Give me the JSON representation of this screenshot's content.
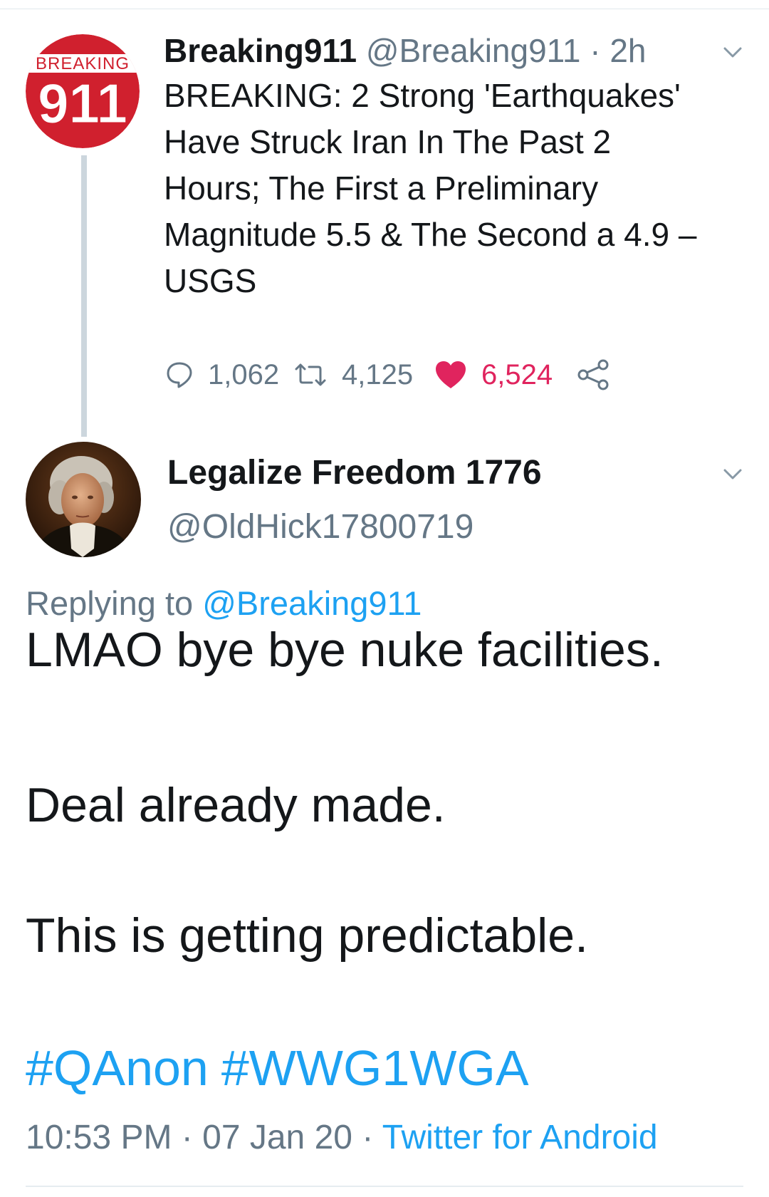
{
  "original_tweet": {
    "avatar_text_top": "BREAKING",
    "avatar_text_big": "911",
    "display_name": "Breaking911",
    "handle": "@Breaking911",
    "separator": "·",
    "time": "2h",
    "text": "BREAKING: 2 Strong 'Earthquakes'\nHave Struck Iran In The Past 2\nHours; The First a Preliminary\nMagnitude 5.5 & The Second a 4.9 –\nUSGS",
    "stats": {
      "replies": "1,062",
      "retweets": "4,125",
      "likes": "6,524"
    },
    "icons": {
      "reply": "reply-icon",
      "retweet": "retweet-icon",
      "like": "heart-icon",
      "share": "share-icon",
      "menu": "chevron-down-icon"
    },
    "colors": {
      "avatar_red": "#d0202e",
      "like_red": "#e0245e"
    }
  },
  "reply_tweet": {
    "display_name": "Legalize Freedom 1776",
    "handle": "@OldHick17800719",
    "replying_prefix": "Replying to",
    "replying_handle": "@Breaking911",
    "lines": [
      "LMAO bye bye nuke facilities.",
      "Deal already made.",
      "This is getting predictable."
    ],
    "hashtags": [
      "#QAnon",
      "#WWG1WGA"
    ],
    "time": "10:53 PM",
    "separator": "·",
    "date": "07 Jan 20",
    "source": "Twitter for Android"
  },
  "colors": {
    "link_blue": "#1da1f2",
    "muted_gray": "#657786",
    "text_dark": "#14171a",
    "divider": "#e6ecf0"
  }
}
